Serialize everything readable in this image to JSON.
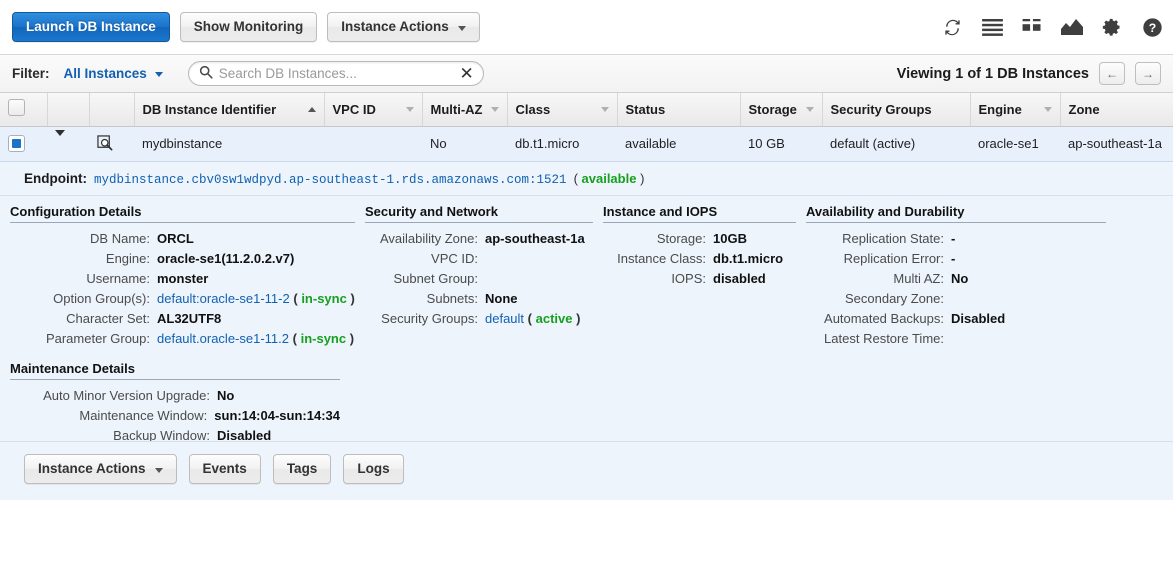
{
  "toolbar": {
    "launch_button": "Launch DB Instance",
    "monitoring_button": "Show Monitoring",
    "instance_actions_button": "Instance Actions",
    "icons": [
      "refresh-icon",
      "list-view-icon",
      "grid-view-icon",
      "chart-icon",
      "gear-icon",
      "help-icon"
    ]
  },
  "filter": {
    "label": "Filter:",
    "selected": "All Instances",
    "search_placeholder": "Search DB Instances...",
    "search_value": "",
    "clear_icon": "close-icon",
    "viewing_text": "Viewing 1 of 1 DB Instances",
    "prev_label": "←",
    "next_label": "→"
  },
  "table": {
    "columns": [
      {
        "label": "DB Instance Identifier",
        "sort": "asc"
      },
      {
        "label": "VPC ID",
        "sort": "none"
      },
      {
        "label": "Multi-AZ",
        "sort": "none"
      },
      {
        "label": "Class",
        "sort": "none"
      },
      {
        "label": "Status",
        "sort": "none"
      },
      {
        "label": "Storage",
        "sort": "none"
      },
      {
        "label": "Security Groups",
        "sort": "none"
      },
      {
        "label": "Engine",
        "sort": "none"
      },
      {
        "label": "Zone",
        "sort": "none"
      }
    ],
    "row": {
      "selected": true,
      "identifier": "mydbinstance",
      "vpc_id": "",
      "multi_az": "No",
      "class": "db.t1.micro",
      "status": "available",
      "storage": "10 GB",
      "security_groups": "default (active)",
      "engine": "oracle-se1",
      "zone": "ap-southeast-1a"
    }
  },
  "detail": {
    "endpoint_label": "Endpoint:",
    "endpoint_url": "mydbinstance.cbv0sw1wdpyd.ap-southeast-1.rds.amazonaws.com:1521",
    "endpoint_status": "available",
    "configuration": {
      "title": "Configuration Details",
      "db_name_label": "DB Name:",
      "db_name": "ORCL",
      "engine_label": "Engine:",
      "engine": "oracle-se1(11.2.0.2.v7)",
      "username_label": "Username:",
      "username": "monster",
      "option_groups_label": "Option Group(s):",
      "option_groups": "default:oracle-se1-11-2",
      "option_groups_status": "in-sync",
      "character_set_label": "Character Set:",
      "character_set": "AL32UTF8",
      "parameter_group_label": "Parameter Group:",
      "parameter_group": "default.oracle-se1-11.2",
      "parameter_group_status": "in-sync"
    },
    "security": {
      "title": "Security and Network",
      "az_label": "Availability Zone:",
      "az": "ap-southeast-1a",
      "vpc_label": "VPC ID:",
      "vpc": "",
      "subnet_group_label": "Subnet Group:",
      "subnet_group": "",
      "subnets_label": "Subnets:",
      "subnets": "None",
      "security_groups_label": "Security Groups:",
      "security_groups": "default",
      "security_groups_status": "active"
    },
    "iops": {
      "title": "Instance and IOPS",
      "storage_label": "Storage:",
      "storage": "10GB",
      "instance_class_label": "Instance Class:",
      "instance_class": "db.t1.micro",
      "iops_label": "IOPS:",
      "iops": "disabled"
    },
    "availability": {
      "title": "Availability and Durability",
      "replication_state_label": "Replication State:",
      "replication_state": "-",
      "replication_error_label": "Replication Error:",
      "replication_error": "-",
      "multi_az_label": "Multi AZ:",
      "multi_az": "No",
      "secondary_zone_label": "Secondary Zone:",
      "secondary_zone": "",
      "automated_backups_label": "Automated Backups:",
      "automated_backups": "Disabled",
      "latest_restore_label": "Latest Restore Time:",
      "latest_restore": ""
    },
    "maintenance": {
      "title": "Maintenance Details",
      "auto_minor_label": "Auto Minor Version Upgrade:",
      "auto_minor": "No",
      "window_label": "Maintenance Window:",
      "window": "sun:14:04-sun:14:34",
      "backup_window_label": "Backup Window:",
      "backup_window": "Disabled"
    }
  },
  "footer": {
    "instance_actions": "Instance Actions",
    "events": "Events",
    "tags": "Tags",
    "logs": "Logs"
  },
  "colors": {
    "accent_blue": "#1161b1",
    "primary_button": "#1b72c8",
    "status_ok": "#17a01f",
    "status_error": "#d10000",
    "panel_bg": "#edf4fc",
    "row_bg": "#e8f1fb"
  }
}
